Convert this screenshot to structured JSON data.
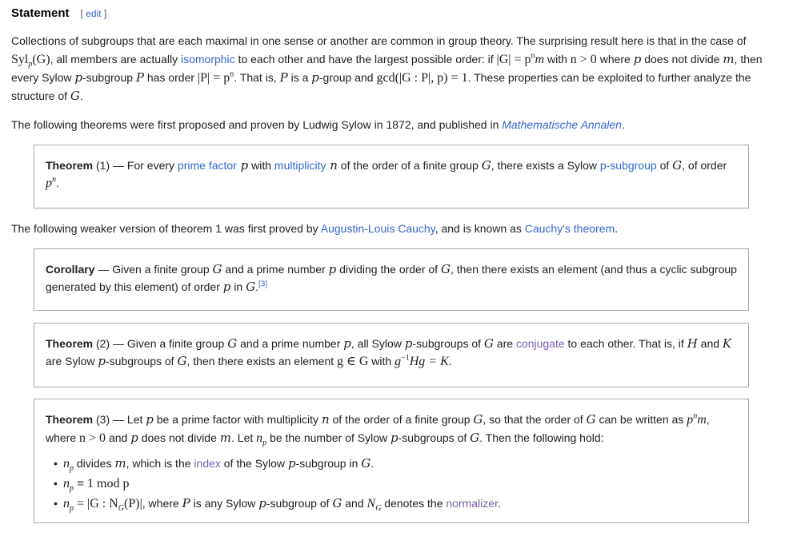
{
  "section": {
    "title": "Statement",
    "edit_open": "[ ",
    "edit_label": "edit",
    "edit_close": " ]"
  },
  "intro": {
    "t1": "Collections of subgroups that are each maximal in one sense or another are common in group theory. The surprising result here is that in the case of ",
    "m_syl": "Syl",
    "m_syl_sub": "p",
    "m_syl_arg": "(G)",
    "t2": ", all members are actually ",
    "link_isomorphic": "isomorphic",
    "t3": " to each other and have the largest possible order: if ",
    "m_order": "|G| = p",
    "m_order_sup": "n",
    "m_order_tail": "m",
    "t4": " with ",
    "m_n": "n > 0",
    "t5": " where ",
    "v_p": "p",
    "t6": " does not divide ",
    "v_m": "m",
    "t7": ", then every Sylow ",
    "v_p2": "p",
    "t8": "-subgroup ",
    "v_P": "P",
    "t9": " has order ",
    "m_P": "|P| = p",
    "m_P_sup": "n",
    "t10": ". That is, ",
    "v_P2": "P",
    "t11": " is a ",
    "v_p3": "p",
    "t12": "-group and ",
    "m_gcd": "gcd(|G : P|, p) = 1",
    "t13": ". These properties can be exploited to further analyze the structure of ",
    "v_G": "G",
    "t14": "."
  },
  "para2": {
    "t1": "The following theorems were first proposed and proven by Ludwig Sylow in 1872, and published in ",
    "link_journal": "Mathematische Annalen",
    "t2": "."
  },
  "theorem1": {
    "title": "Theorem",
    "num": " (1) — For every ",
    "link_prime": "prime factor",
    "v_p": " p",
    "t1": " with ",
    "link_mult": "multiplicity",
    "v_n": " n",
    "t2": " of the order of a finite group ",
    "v_G": "G",
    "t3": ", there exists a Sylow ",
    "link_psub": "p-subgroup",
    "t4": " of ",
    "v_G2": "G",
    "t5": ", of order ",
    "m": "p",
    "m_sup": "n",
    "t6": "."
  },
  "para3": {
    "t1": "The following weaker version of theorem 1 was first proved by ",
    "link_cauchy": "Augustin-Louis Cauchy",
    "t2": ", and is known as ",
    "link_thm": "Cauchy's theorem",
    "t3": "."
  },
  "corollary": {
    "title": "Corollary",
    "t1": " — Given a finite group ",
    "v_G": "G",
    "t2": " and a prime number ",
    "v_p": "p",
    "t3": " dividing the order of ",
    "v_G2": "G",
    "t4": ", then there exists an element (and thus a cyclic subgroup generated by this element) of order ",
    "v_p2": "p",
    "t5": " in ",
    "v_G3": "G",
    "t6": ".",
    "ref": "[3]"
  },
  "theorem2": {
    "title": "Theorem",
    "t1": " (2) — Given a finite group ",
    "v_G": "G",
    "t2": " and a prime number ",
    "v_p": "p",
    "t3": ", all Sylow ",
    "v_p2": "p",
    "t4": "-subgroups of ",
    "v_G2": "G",
    "t5": " are ",
    "link_conj": "conjugate",
    "t6": " to each other. That is, if ",
    "v_H": "H",
    "t7": " and ",
    "v_K": "K",
    "t8": " are Sylow ",
    "v_p3": "p",
    "t9": "-subgroups of ",
    "v_G3": "G",
    "t10": ", then there exists an element ",
    "m1": "g ∈ G",
    "t11": " with ",
    "m2a": "g",
    "m2sup": "−1",
    "m2b": "Hg = K",
    "t12": "."
  },
  "theorem3": {
    "title": "Theorem",
    "t1": " (3) — Let ",
    "v_p": "p",
    "t2": " be a prime factor with multiplicity ",
    "v_n": "n",
    "t3": " of the order of a finite group ",
    "v_G": "G",
    "t4": ", so that the order of ",
    "v_G2": "G",
    "t5": " can be written as ",
    "m1": "p",
    "m1sup": "n",
    "m1tail": "m",
    "t6": ", where ",
    "m2": "n > 0",
    "t7": " and ",
    "v_p2": "p",
    "t8": " does not divide ",
    "v_m": "m",
    "t9": ". Let ",
    "m3": "n",
    "m3sub": "p",
    "t10": " be the number of Sylow ",
    "v_p3": "p",
    "t11": "-subgroups of ",
    "v_G3": "G",
    "t12": ". Then the following hold:",
    "items": [
      {
        "m": "n",
        "msub": "p",
        "t1": " divides ",
        "v_m": "m",
        "t2": ", which is the ",
        "link": "index",
        "t3": " of the Sylow ",
        "v_p": "p",
        "t4": "-subgroup in ",
        "v_G": "G",
        "t5": "."
      },
      {
        "m": "n",
        "msub": "p",
        "mtail": " ≡ 1 mod p"
      },
      {
        "m": "n",
        "msub": "p",
        "mtail": " = |G : N",
        "msub2": "G",
        "mtail2": "(P)|",
        "t1": ", where ",
        "v_P": "P",
        "t2": " is any Sylow ",
        "v_p": "p",
        "t3": "-subgroup of ",
        "v_G": "G",
        "t4": " and ",
        "m2": "N",
        "m2sub": "G",
        "t5": " denotes the ",
        "link": "normalizer",
        "t6": "."
      }
    ]
  }
}
